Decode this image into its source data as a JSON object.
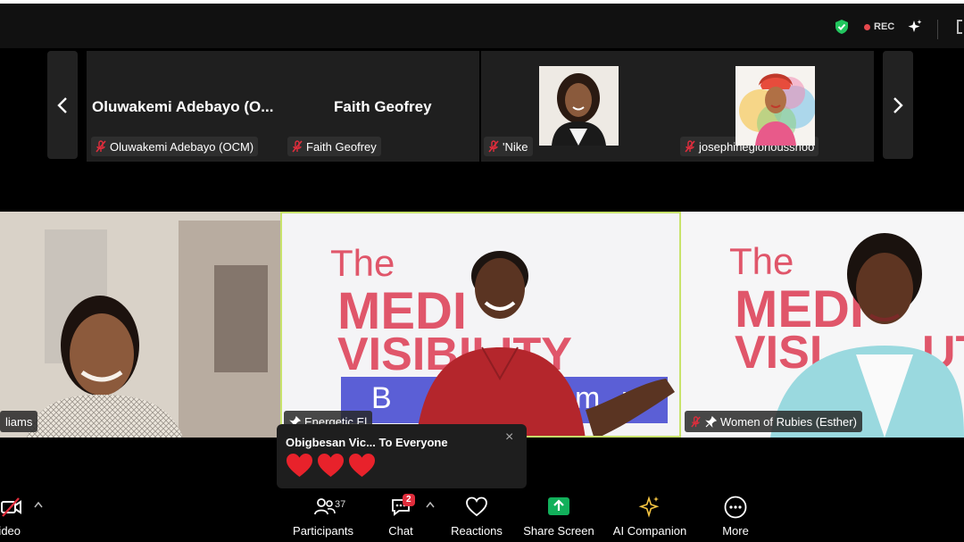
{
  "topbar": {
    "rec_label": "REC",
    "icons": [
      "shield-check-icon",
      "record-dot-icon",
      "ai-sparkle-icon"
    ]
  },
  "strip": {
    "tiles": [
      {
        "display_name": "Oluwakemi Adebayo (O...",
        "chip_label": "Oluwakemi Adebayo (OCM)"
      },
      {
        "display_name": "Faith Geofrey",
        "chip_label": "Faith Geofrey"
      },
      {
        "chip_label": "'Nike"
      },
      {
        "chip_label": "josephinegloriousshoo"
      }
    ]
  },
  "gallery": {
    "tiles": [
      {
        "chip_label": "liams"
      },
      {
        "chip_label": "Energetic El",
        "banner_lines": [
          "The",
          "MEDI",
          "VISIBILITY",
          "B",
          "m",
          "r"
        ]
      },
      {
        "chip_label": "Women of Rubies (Esther)",
        "banner_lines": [
          "The",
          "MEDI",
          "VISI",
          "UT"
        ]
      }
    ]
  },
  "reaction": {
    "sender": "Obigbesan Vic... To Everyone",
    "close": "×",
    "heart_count": 3
  },
  "toolbar": {
    "video_label": "Video",
    "participants_label": "Participants",
    "participants_count": "37",
    "chat_label": "Chat",
    "chat_badge": "2",
    "reactions_label": "Reactions",
    "share_label": "Share Screen",
    "ai_label": "AI Companion",
    "more_label": "More"
  },
  "colors": {
    "share_green": "#12b05b",
    "rec_red": "#e5484d",
    "active_speaker_border": "#c8e36b",
    "heart_red": "#e8222b",
    "banner_pink": "#e0566a",
    "banner_blue": "#5b5fd6"
  }
}
